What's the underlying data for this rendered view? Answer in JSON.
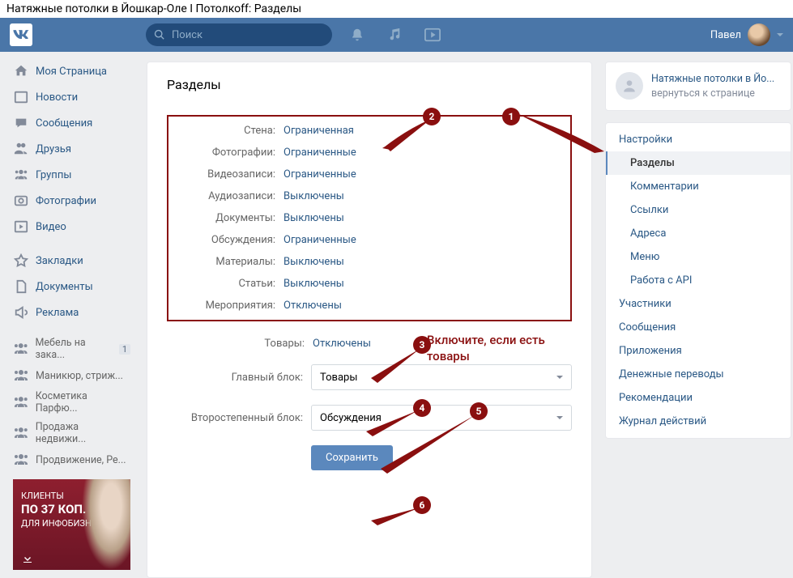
{
  "page_title": "Натяжные потолки в Йошкар-Оле I Потолкоff: Разделы",
  "header": {
    "search_placeholder": "Поиск",
    "user_name": "Павел"
  },
  "left_nav": {
    "items": [
      {
        "label": "Моя Страница",
        "icon": "home"
      },
      {
        "label": "Новости",
        "icon": "news"
      },
      {
        "label": "Сообщения",
        "icon": "messages"
      },
      {
        "label": "Друзья",
        "icon": "friends"
      },
      {
        "label": "Группы",
        "icon": "groups"
      },
      {
        "label": "Фотографии",
        "icon": "photos"
      },
      {
        "label": "Видео",
        "icon": "video"
      }
    ],
    "items2": [
      {
        "label": "Закладки",
        "icon": "bookmarks"
      },
      {
        "label": "Документы",
        "icon": "docs"
      },
      {
        "label": "Реклама",
        "icon": "ads"
      }
    ],
    "shortcuts": [
      {
        "label": "Мебель на зака...",
        "badge": "1"
      },
      {
        "label": "Маникюр, стриж..."
      },
      {
        "label": "Косметика Парфю..."
      },
      {
        "label": "Продажа недвижи..."
      },
      {
        "label": "Продвижение, Ре..."
      }
    ]
  },
  "ad": {
    "line1": "КЛИЕНТЫ",
    "line2": "ПО 37 КОП.",
    "line3": "ДЛЯ ИНФОБИЗНЕСА"
  },
  "content": {
    "title": "Разделы",
    "settings": [
      {
        "label": "Стена:",
        "value": "Ограниченная"
      },
      {
        "label": "Фотографии:",
        "value": "Ограниченные"
      },
      {
        "label": "Видеозаписи:",
        "value": "Ограниченные"
      },
      {
        "label": "Аудиозаписи:",
        "value": "Выключены"
      },
      {
        "label": "Документы:",
        "value": "Выключены"
      },
      {
        "label": "Обсуждения:",
        "value": "Ограниченные"
      },
      {
        "label": "Материалы:",
        "value": "Выключены"
      },
      {
        "label": "Статьи:",
        "value": "Выключены"
      },
      {
        "label": "Мероприятия:",
        "value": "Отключены"
      }
    ],
    "goods_label": "Товары:",
    "goods_value": "Отключены",
    "main_block_label": "Главный блок:",
    "main_block_value": "Товары",
    "second_block_label": "Второстепенный блок:",
    "second_block_value": "Обсуждения",
    "save_label": "Сохранить"
  },
  "right": {
    "group_name": "Натяжные потолки в Йо...",
    "group_back": "вернуться к странице",
    "menu": [
      {
        "label": "Настройки",
        "sub": false
      },
      {
        "label": "Разделы",
        "sub": true,
        "active": true
      },
      {
        "label": "Комментарии",
        "sub": true
      },
      {
        "label": "Ссылки",
        "sub": true
      },
      {
        "label": "Адреса",
        "sub": true
      },
      {
        "label": "Меню",
        "sub": true
      },
      {
        "label": "Работа с API",
        "sub": true
      },
      {
        "label": "Участники",
        "sub": false
      },
      {
        "label": "Сообщения",
        "sub": false
      },
      {
        "label": "Приложения",
        "sub": false
      },
      {
        "label": "Денежные переводы",
        "sub": false
      },
      {
        "label": "Рекомендации",
        "sub": false
      },
      {
        "label": "Журнал действий",
        "sub": false
      }
    ]
  },
  "annotations": {
    "hint_text": "Включите, если есть товары"
  }
}
